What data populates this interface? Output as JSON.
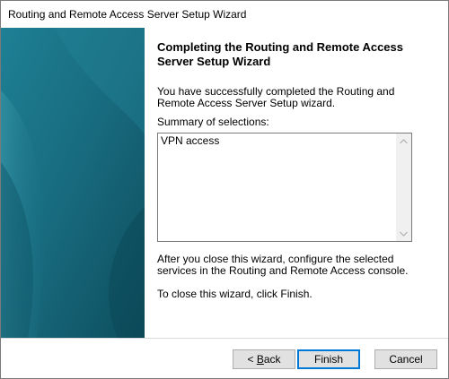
{
  "window": {
    "title": "Routing and Remote Access Server Setup Wizard"
  },
  "content": {
    "heading": "Completing the Routing and Remote Access Server Setup Wizard",
    "intro": "You have successfully completed the Routing and Remote Access Server Setup wizard.",
    "summary_label": "Summary of selections:",
    "summary_items": [
      "VPN access"
    ],
    "after_close": "After you close this wizard, configure the selected services in the Routing and  Remote Access console.",
    "close_instruction": "To close this wizard, click Finish."
  },
  "buttons": {
    "back_prefix": "< ",
    "back_accel": "B",
    "back_rest": "ack",
    "finish": "Finish",
    "cancel": "Cancel"
  },
  "icons": {
    "scroll_up": "chevron-up-icon",
    "scroll_down": "chevron-down-icon"
  },
  "colors": {
    "default_button_border": "#0078d7",
    "banner_teal": "#1a6f83"
  }
}
